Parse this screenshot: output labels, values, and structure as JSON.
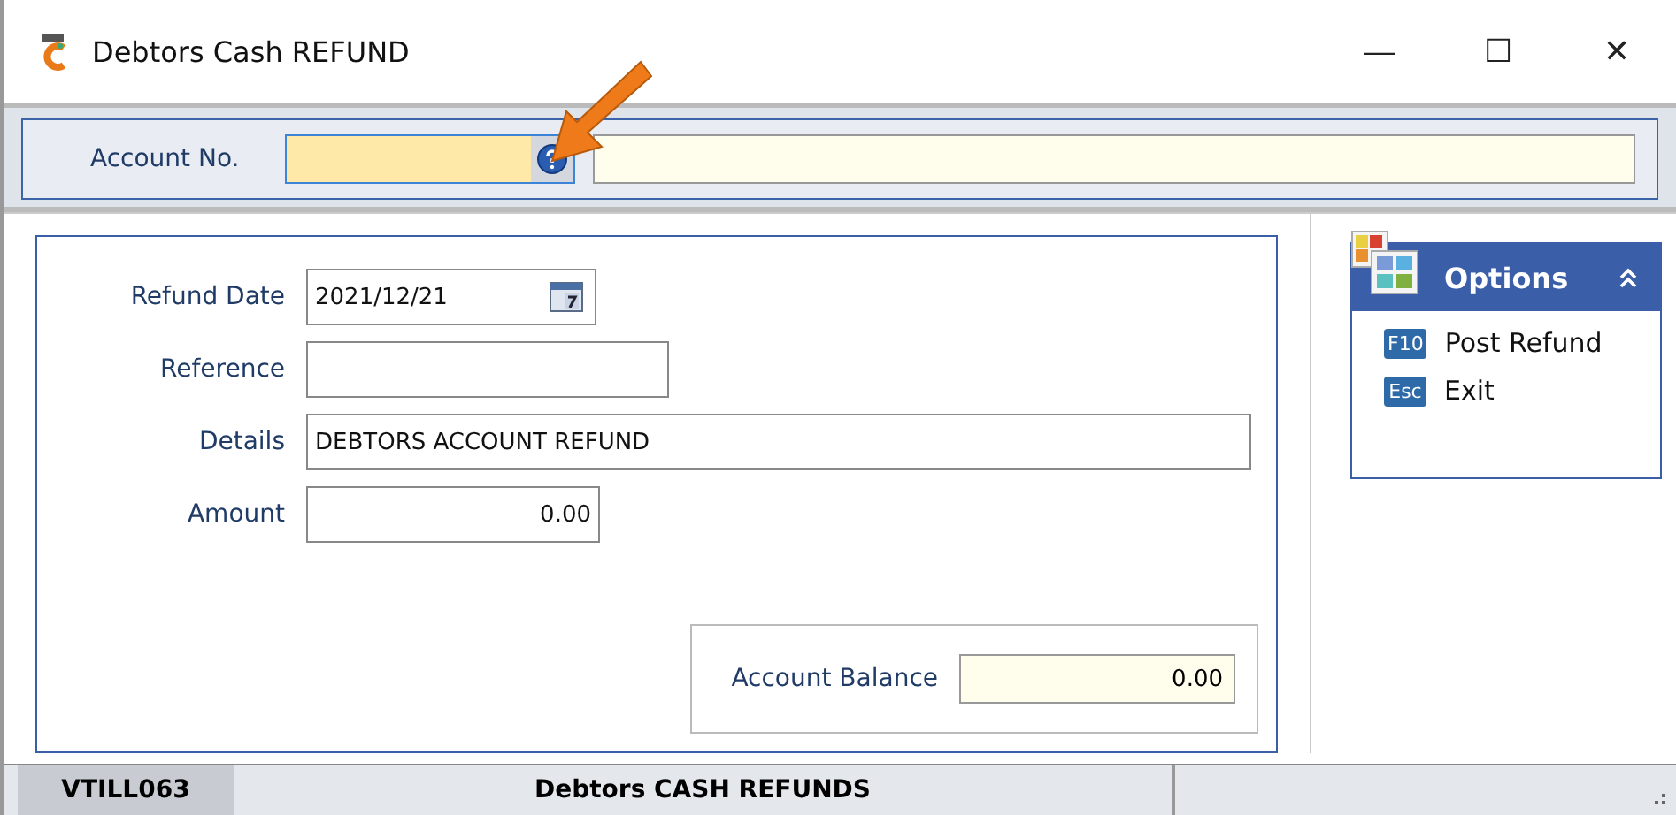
{
  "window": {
    "title": "Debtors Cash REFUND",
    "controls": [
      "—",
      "☐",
      "✕"
    ]
  },
  "account": {
    "label": "Account No."
  },
  "form": {
    "fields": [
      {
        "label": "Refund Date",
        "value": "2021/12/21",
        "kind": "date"
      },
      {
        "label": "Reference",
        "kind": "text"
      },
      {
        "label": "Details",
        "value": "DEBTORS ACCOUNT REFUND",
        "kind": "text"
      },
      {
        "label": "Amount",
        "value": "0.00",
        "kind": "amount"
      }
    ],
    "balance": {
      "label": "Account Balance",
      "value": "0.00"
    }
  },
  "options": {
    "title": "Options",
    "items": [
      {
        "key": "F10",
        "label": "Post Refund"
      },
      {
        "key": "Esc",
        "label": "Exit"
      }
    ]
  },
  "status_bar": {
    "code": "VTILL063",
    "title": "Debtors CASH REFUNDS"
  }
}
